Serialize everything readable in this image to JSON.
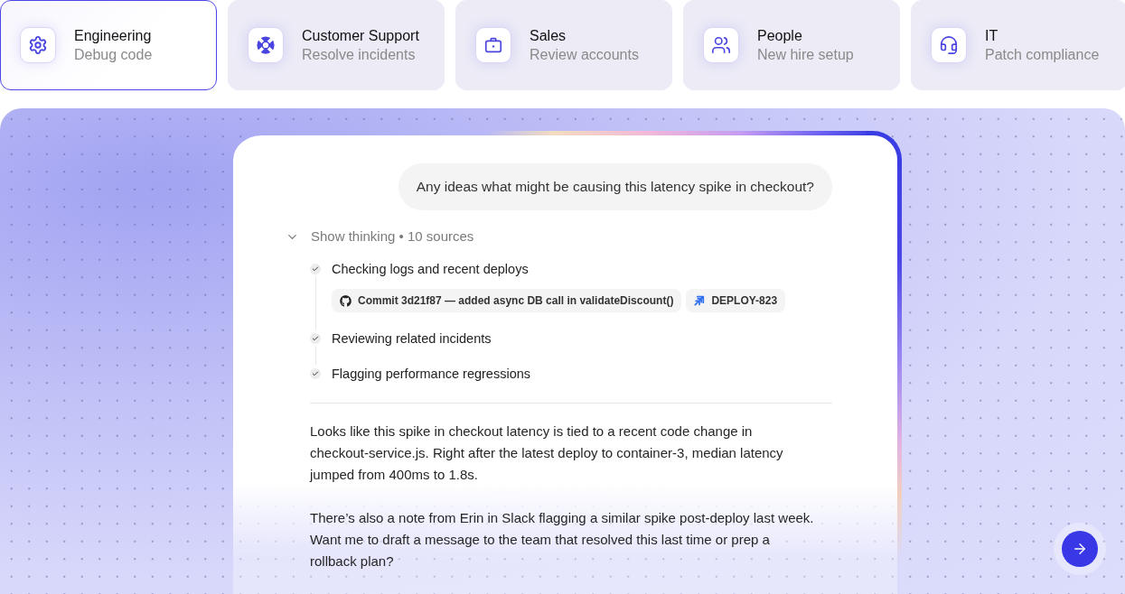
{
  "categories": [
    {
      "title": "Engineering",
      "subtitle": "Debug code",
      "selected": true
    },
    {
      "title": "Customer Support",
      "subtitle": "Resolve incidents",
      "selected": false
    },
    {
      "title": "Sales",
      "subtitle": "Review accounts",
      "selected": false
    },
    {
      "title": "People",
      "subtitle": "New hire setup",
      "selected": false
    },
    {
      "title": "IT",
      "subtitle": "Patch compliance",
      "selected": false
    }
  ],
  "chat": {
    "user_message": "Any ideas what might be causing this latency spike in checkout?",
    "thinking": {
      "label": "Show thinking • 10 sources",
      "expanded": true,
      "steps": [
        {
          "text": "Checking logs and recent deploys",
          "done": true,
          "sources": [
            {
              "kind": "commit",
              "label": "Commit 3d21f87 — added async DB call in validateDiscount()"
            },
            {
              "kind": "ticket",
              "label": "DEPLOY-823"
            }
          ]
        },
        {
          "text": "Reviewing related incidents",
          "done": true
        },
        {
          "text": "Flagging performance regressions",
          "done": true
        }
      ]
    },
    "response": [
      "Looks like this spike in checkout latency is tied to a recent code change in checkout-service.js. Right after the latest deploy to container-3, median latency jumped from 400ms to 1.8s.",
      "There’s also a note from Erin in Slack flagging a similar spike post-deploy last week. Want me to draft a message to the team that resolved this last time or prep a rollback plan?"
    ]
  }
}
